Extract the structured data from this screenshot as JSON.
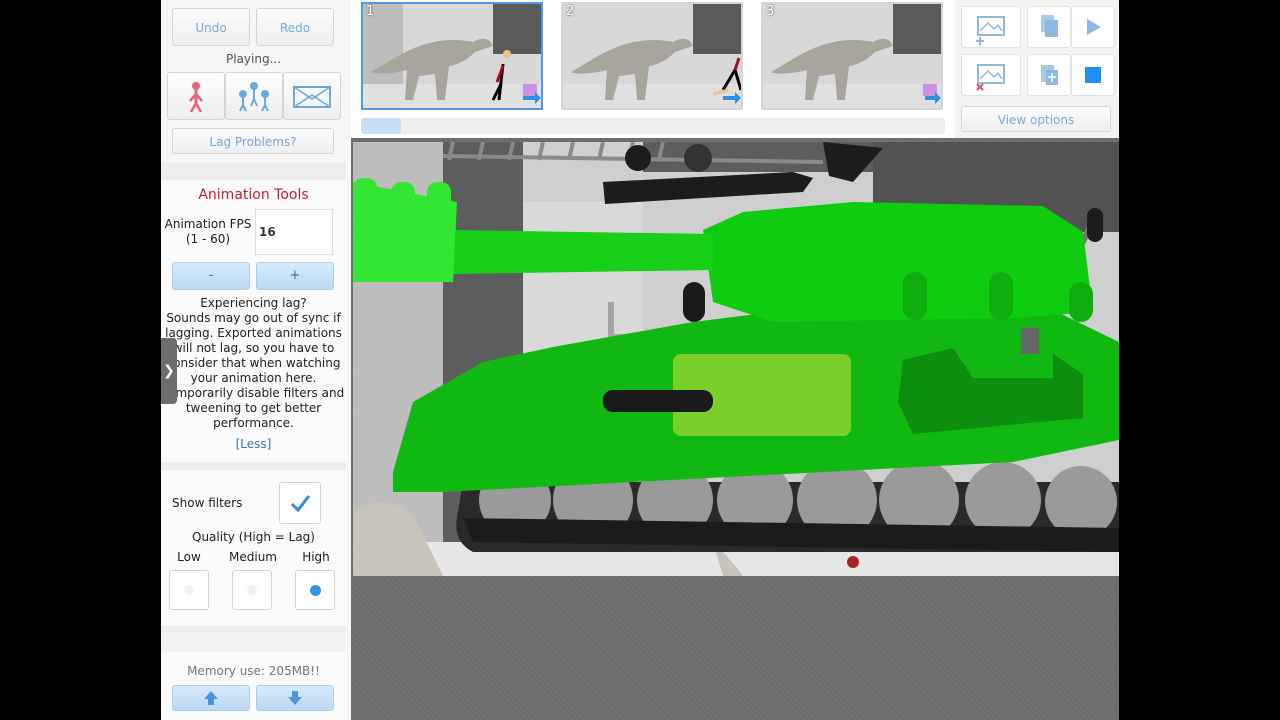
{
  "history": {
    "undo_label": "Undo",
    "redo_label": "Redo",
    "status": "Playing..."
  },
  "lag_button_label": "Lag Problems?",
  "animation_tools": {
    "heading": "Animation Tools",
    "fps_label_line1": "Animation FPS",
    "fps_label_line2": "(1 - 60)",
    "fps_value": "16",
    "minus_label": "-",
    "plus_label": "+",
    "lag_title": "Experiencing lag?",
    "lag_lines": [
      "Sounds may go out of sync if",
      "lagging. Exported animations",
      "will not lag, so you have to",
      "consider that when watching",
      "your animation here.",
      "Temporarily disable filters and",
      "tweening to get better",
      "performance."
    ],
    "less_link": "[Less]"
  },
  "filters": {
    "show_filters_label": "Show filters",
    "show_filters_checked": true,
    "quality_label": "Quality (High = Lag)",
    "options": [
      "Low",
      "Medium",
      "High"
    ],
    "selected": "High"
  },
  "memory": {
    "label": "Memory use: 205MB!!"
  },
  "frames": [
    {
      "number": "1",
      "selected": true
    },
    {
      "number": "2",
      "selected": false
    },
    {
      "number": "3",
      "selected": false
    }
  ],
  "right_tools": {
    "view_options_label": "View options"
  },
  "collapse_tab_glyph": "❯",
  "colors": {
    "accent_blue": "#4b9be8",
    "tank_green": "#0fbf0f",
    "tank_light_green": "#7fcf25",
    "heading_red": "#c21d35"
  },
  "icons": [
    "stickman-icon",
    "group-icon",
    "background-icon",
    "add-frame-icon",
    "delete-frame-icon",
    "copy-icon",
    "paste-icon",
    "play-icon",
    "stop-icon",
    "checkmark-icon",
    "arrow-up-icon",
    "arrow-down-icon",
    "expand-panel-icon"
  ]
}
